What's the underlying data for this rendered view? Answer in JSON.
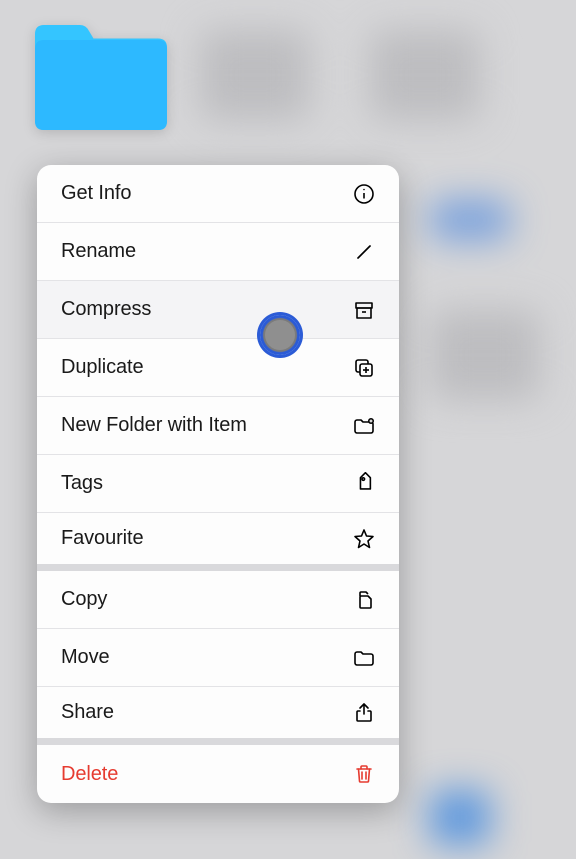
{
  "selected_item": {
    "type": "folder",
    "color": "#2db9ff"
  },
  "menu": {
    "items": [
      {
        "label": "Get Info",
        "icon": "info",
        "destructive": false
      },
      {
        "label": "Rename",
        "icon": "pencil",
        "destructive": false
      },
      {
        "label": "Compress",
        "icon": "archive",
        "destructive": false,
        "highlighted": true
      },
      {
        "label": "Duplicate",
        "icon": "duplicate",
        "destructive": false
      },
      {
        "label": "New Folder with Item",
        "icon": "folder-plus",
        "destructive": false
      },
      {
        "label": "Tags",
        "icon": "tag",
        "destructive": false
      },
      {
        "label": "Favourite",
        "icon": "star",
        "destructive": false
      },
      {
        "label": "Copy",
        "icon": "doc-on-doc",
        "destructive": false
      },
      {
        "label": "Move",
        "icon": "folder",
        "destructive": false
      },
      {
        "label": "Share",
        "icon": "share",
        "destructive": false
      },
      {
        "label": "Delete",
        "icon": "trash",
        "destructive": true
      }
    ]
  }
}
